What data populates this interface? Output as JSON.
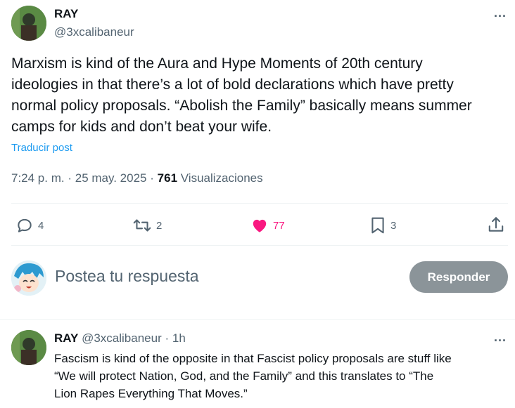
{
  "tweet": {
    "author_name": "RAY",
    "author_handle": "@3xcalibaneur",
    "text_lines": [
      "Marxism is kind of the Aura and Hype Moments of 20th century",
      "ideologies in that there’s a lot of bold declarations which have pretty",
      "normal policy proposals. “Abolish the Family” basically means summer",
      "camps for kids and don’t beat your wife."
    ],
    "translate": "Traducir post",
    "time": "7:24 p. m.",
    "sep1": "·",
    "date": "25 may. 2025",
    "sep2": "·",
    "views_count": "761",
    "views_label": "Visualizaciones",
    "more_icon": "...",
    "actions": {
      "replies": "4",
      "reposts": "2",
      "likes": "77",
      "bookmarks": "3"
    }
  },
  "compose": {
    "placeholder": "Postea tu respuesta",
    "button": "Responder"
  },
  "reply": {
    "author_name": "RAY",
    "author_handle": "@3xcalibaneur",
    "sep": "·",
    "age": "1h",
    "more_icon": "...",
    "text_lines": [
      "Fascism is kind of the opposite in that Fascist policy proposals are stuff like",
      "“We will protect Nation, God, and the Family” and this translates to “The",
      "Lion Rapes Everything That Moves.”"
    ]
  },
  "colors": {
    "like": "#f91880",
    "link": "#1d9bf0",
    "muted": "#536471",
    "button_bg": "#8b9499"
  }
}
